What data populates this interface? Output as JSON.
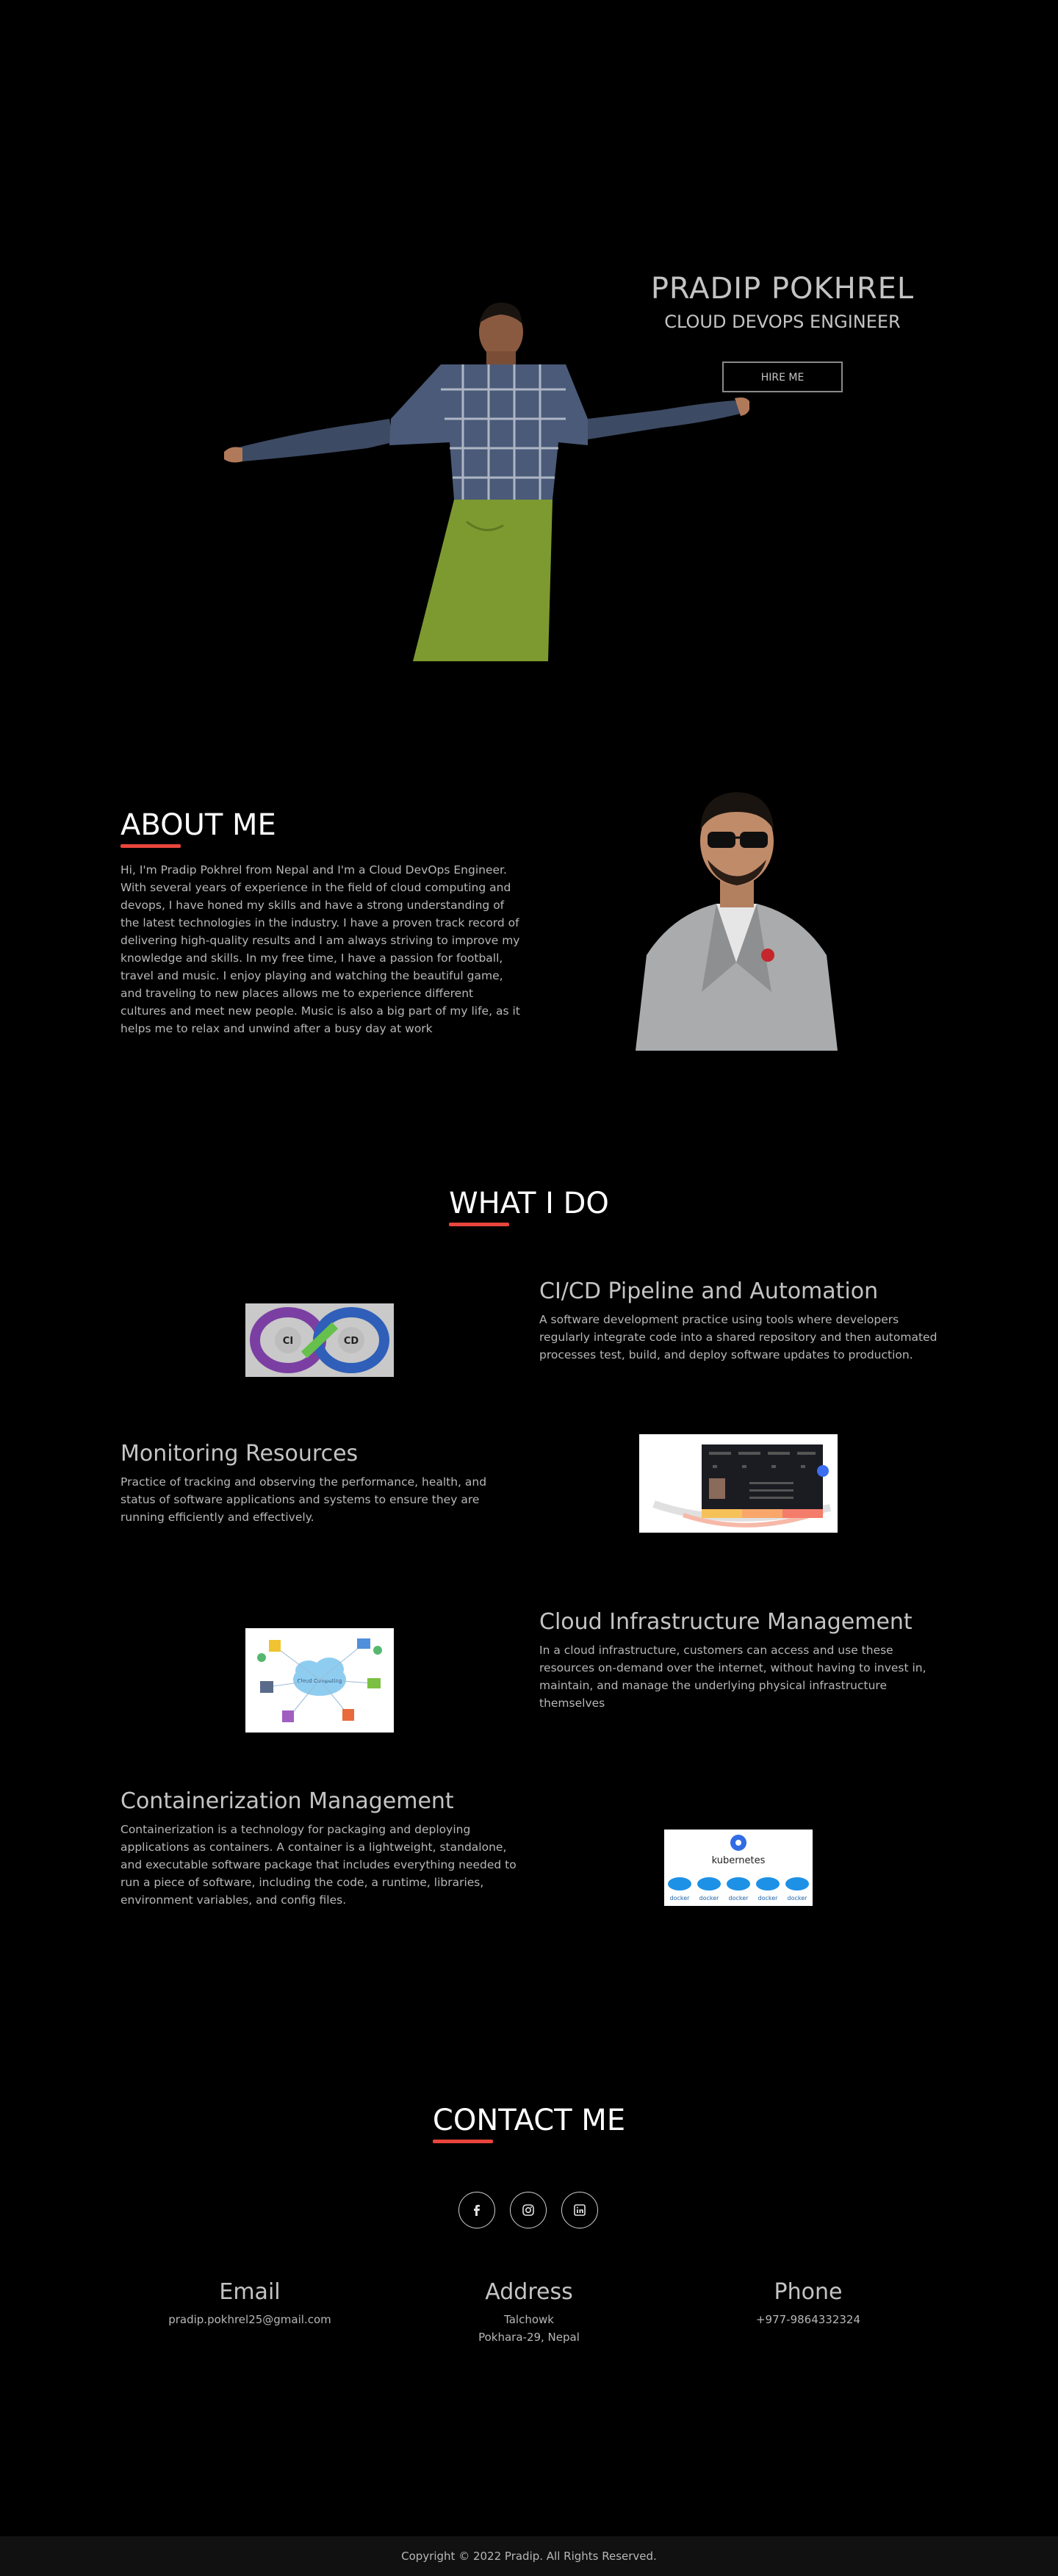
{
  "hero": {
    "name": "PRADIP POKHREL",
    "role": "CLOUD DEVOPS ENGINEER",
    "hire_label": "HIRE ME"
  },
  "about": {
    "title": "ABOUT ME",
    "text": "Hi, I'm Pradip Pokhrel from Nepal and I'm a Cloud DevOps Engineer. With several years of experience in the field of cloud computing and devops, I have honed my skills and have a strong understanding of the latest technologies in the industry. I have a proven track record of delivering high-quality results and I am always striving to improve my knowledge and skills. In my free time, I have a passion for football, travel and music. I enjoy playing and watching the beautiful game, and traveling to new places allows me to experience different cultures and meet new people. Music is also a big part of my life, as it helps me to relax and unwind after a busy day at work"
  },
  "services": {
    "title": "WHAT I DO",
    "items": [
      {
        "title": "CI/CD Pipeline and Automation",
        "text": "A software development practice using tools where developers regularly integrate code into a shared repository and then automated processes test, build, and deploy software updates to production.",
        "img_labels": [
          "CI",
          "CD"
        ]
      },
      {
        "title": "Monitoring Resources",
        "text": "Practice of tracking and observing the performance, health, and status of software applications and systems to ensure they are running efficiently and effectively."
      },
      {
        "title": "Cloud Infrastructure Management",
        "text": "In a cloud infrastructure, customers can access and use these resources on-demand over the internet, without having to invest in, maintain, and manage the underlying physical infrastructure themselves",
        "img_label": "Cloud Computing"
      },
      {
        "title": "Containerization Management",
        "text": "Containerization is a technology for packaging and deploying applications as containers. A container is a lightweight, standalone, and executable software package that includes everything needed to run a piece of software, including the code, a runtime, libraries, environment variables, and config files.",
        "img_label": "kubernetes",
        "docker_label": "docker"
      }
    ]
  },
  "contact": {
    "title": "CONTACT ME",
    "socials": [
      "facebook-icon",
      "instagram-icon",
      "linkedin-icon"
    ],
    "email_label": "Email",
    "email_value": "pradip.pokhrel25@gmail.com",
    "address_label": "Address",
    "address_line1": "Talchowk",
    "address_line2": "Pokhara-29, Nepal",
    "phone_label": "Phone",
    "phone_value": "+977-9864332324"
  },
  "footer": {
    "copyright": "Copyright © 2022 Pradip. All Rights Reserved."
  },
  "colors": {
    "background": "#000000",
    "accent": "#e8453c",
    "text": "#bfbfbf"
  }
}
